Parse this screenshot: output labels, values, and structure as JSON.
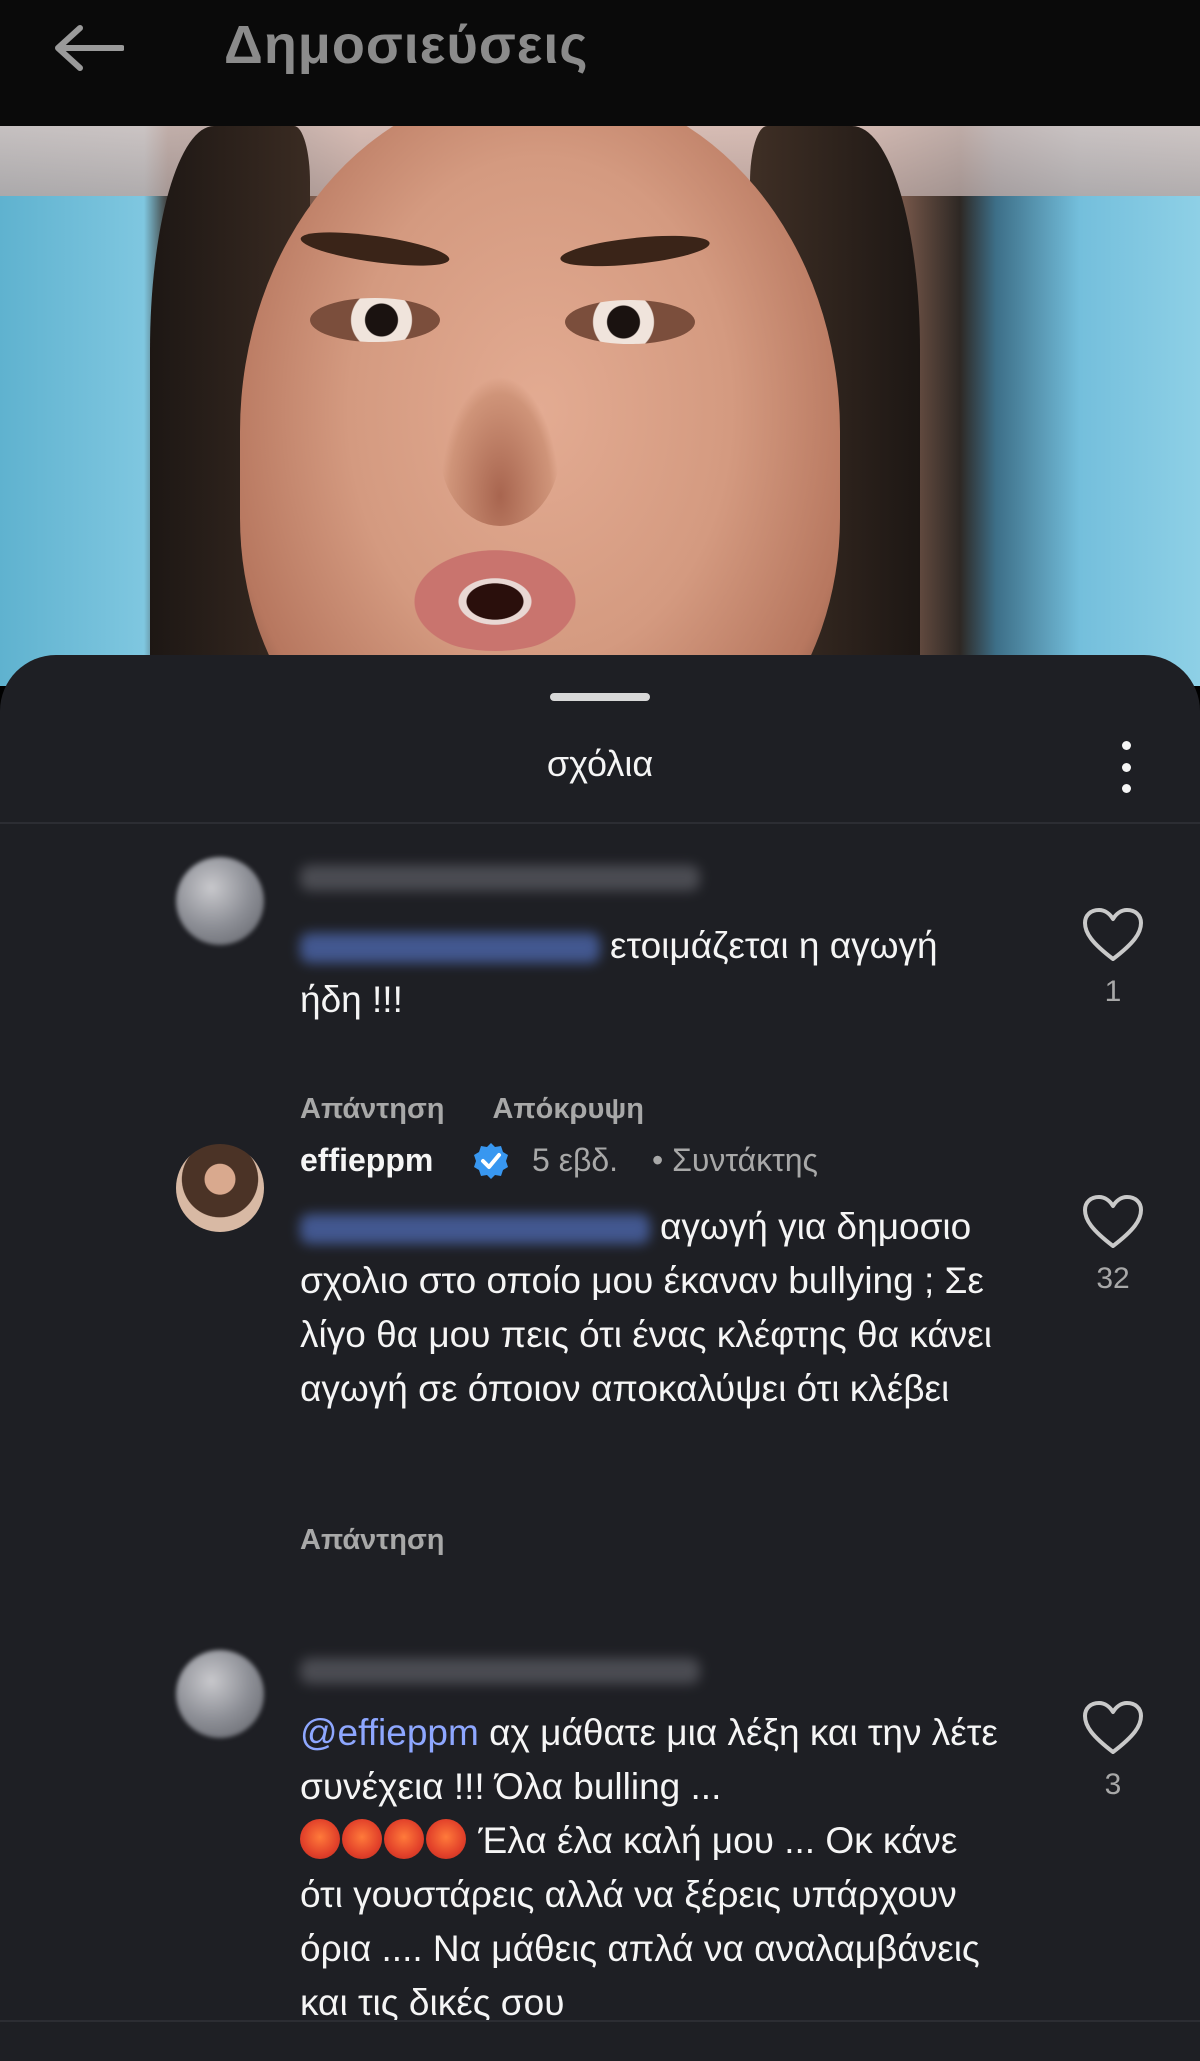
{
  "header": {
    "title": "Δημοσιεύσεις"
  },
  "sheet": {
    "title": "σχόλια"
  },
  "comments": [
    {
      "text": "ετοιμάζεται η αγωγή ήδη !!!",
      "reply_label": "Απάντηση",
      "hide_label": "Απόκρυψη",
      "likes": "1"
    },
    {
      "username": "effieppm",
      "time": "5 εβδ.",
      "role": "• Συντάκτης",
      "text": "αγωγή για δημοσιο σχολιο στο οποίο μου έκαναν bullying ; Σε λίγο θα μου πεις ότι ένας κλέφτης θα κάνει αγωγή σε όποιον αποκαλύψει ότι κλέβει",
      "reply_label": "Απάντηση",
      "likes": "32"
    },
    {
      "mention": "@effieppm",
      "text_part1": "αχ μάθατε μια λέξη και την λέτε συνέχεια !!! Όλα bulling ...",
      "text_part2": "Έλα έλα καλή μου ... Οκ κάνε ότι γουστάρεις αλλά να ξέρεις υπάρχουν όρια .... Να μάθεις απλά να αναλαμβάνεις και τις δικές σου",
      "likes": "3"
    }
  ],
  "icons": {
    "back": "arrow-left-icon",
    "more": "more-vertical-icon",
    "like": "heart-outline-icon",
    "verified": "verified-badge-icon",
    "emoji": "face-with-symbols-emoji"
  },
  "colors": {
    "mention": "#8ea7ff",
    "verified": "#3897f0",
    "sheet": "#1e1f24"
  }
}
